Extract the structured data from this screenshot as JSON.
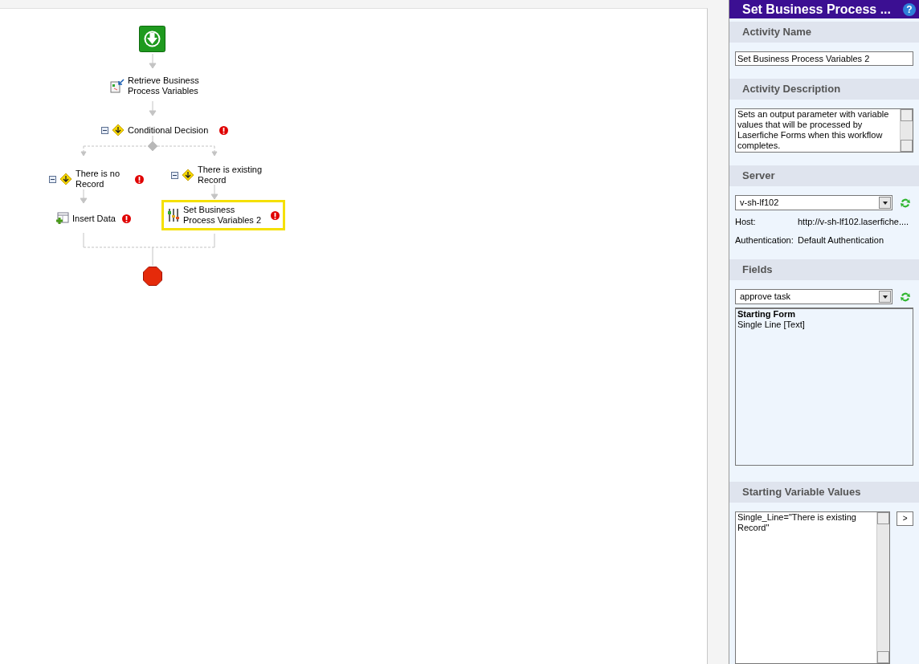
{
  "flow": {
    "nodes": [
      {
        "kind": "start"
      },
      {
        "kind": "action",
        "label": "Retrieve Business Process Variables",
        "error": false,
        "collapsible": false,
        "selected": false
      },
      {
        "kind": "decision",
        "label": "Conditional Decision",
        "error": true,
        "collapsible": true,
        "selected": false
      },
      {
        "kind": "decision",
        "label": "There is no Record",
        "error": true,
        "collapsible": true,
        "selected": false
      },
      {
        "kind": "decision",
        "label": "There is existing Record",
        "error": false,
        "collapsible": true,
        "selected": false
      },
      {
        "kind": "action",
        "label": "Insert Data",
        "error": true,
        "collapsible": false,
        "selected": false
      },
      {
        "kind": "action",
        "label": "Set Business Process Variables 2",
        "error": true,
        "collapsible": false,
        "selected": true
      },
      {
        "kind": "end"
      }
    ]
  },
  "panel": {
    "title": "Set Business Process ...",
    "help": "?",
    "sections": [
      {
        "kind": "text",
        "heading": "Activity Name",
        "value": "Set Business Process Variables 2"
      },
      {
        "kind": "textarea",
        "heading": "Activity Description",
        "value": "Sets an output parameter with variable values that will be processed by Laserfiche Forms when this workflow completes."
      },
      {
        "kind": "server",
        "heading": "Server",
        "value": "v-sh-lf102",
        "rows": [
          {
            "label": "Host:",
            "value": "http://v-sh-lf102.laserfiche...."
          },
          {
            "label": "Authentication:",
            "value": "Default Authentication"
          }
        ]
      },
      {
        "kind": "fields",
        "heading": "Fields",
        "value": "approve task",
        "groups": [
          {
            "title": "Starting Form",
            "items": [
              "Single Line [Text]"
            ]
          }
        ]
      },
      {
        "kind": "values",
        "heading": "Starting Variable Values",
        "value": "Single_Line=\"There is existing Record\"",
        "button": ">"
      }
    ]
  }
}
